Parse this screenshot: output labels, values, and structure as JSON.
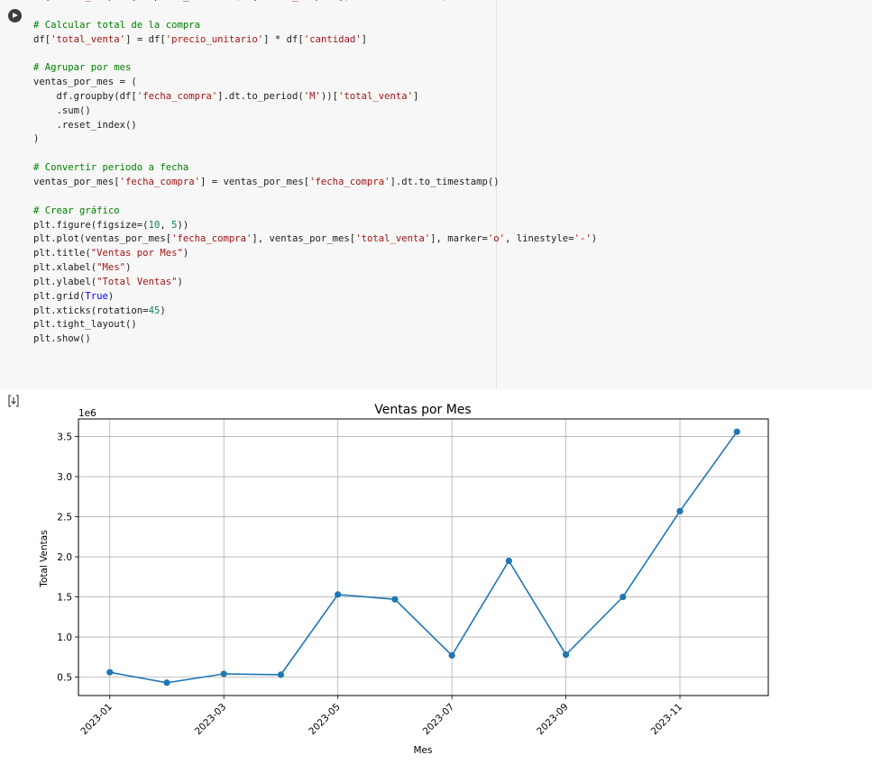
{
  "code_lines": [
    [
      [
        "df[",
        "tok-text"
      ],
      [
        "'fecha_compra'",
        "tok-string"
      ],
      [
        "] = pd.to_datetime(df[",
        "tok-text"
      ],
      [
        "'fecha_compra'",
        "tok-string"
      ],
      [
        "], errors=",
        "tok-text"
      ],
      [
        "'coerce'",
        "tok-string"
      ],
      [
        ")",
        "tok-text"
      ]
    ],
    [],
    [
      [
        "# Calcular total de la compra",
        "tok-comment"
      ]
    ],
    [
      [
        "df[",
        "tok-text"
      ],
      [
        "'total_venta'",
        "tok-string"
      ],
      [
        "] = df[",
        "tok-text"
      ],
      [
        "'precio_unitario'",
        "tok-string"
      ],
      [
        "] * df[",
        "tok-text"
      ],
      [
        "'cantidad'",
        "tok-string"
      ],
      [
        "]",
        "tok-text"
      ]
    ],
    [],
    [
      [
        "# Agrupar por mes",
        "tok-comment"
      ]
    ],
    [
      [
        "ventas_por_mes = (",
        "tok-text"
      ]
    ],
    [
      [
        "    df.groupby(df[",
        "tok-text"
      ],
      [
        "'fecha_compra'",
        "tok-string"
      ],
      [
        "].dt.to_period(",
        "tok-text"
      ],
      [
        "'M'",
        "tok-string"
      ],
      [
        "))[",
        "tok-text"
      ],
      [
        "'total_venta'",
        "tok-string"
      ],
      [
        "]",
        "tok-text"
      ]
    ],
    [
      [
        "    .sum()",
        "tok-text"
      ]
    ],
    [
      [
        "    .reset_index()",
        "tok-text"
      ]
    ],
    [
      [
        ")",
        "tok-text"
      ]
    ],
    [],
    [
      [
        "# Convertir periodo a fecha",
        "tok-comment"
      ]
    ],
    [
      [
        "ventas_por_mes[",
        "tok-text"
      ],
      [
        "'fecha_compra'",
        "tok-string"
      ],
      [
        "] = ventas_por_mes[",
        "tok-text"
      ],
      [
        "'fecha_compra'",
        "tok-string"
      ],
      [
        "].dt.to_timestamp()",
        "tok-text"
      ]
    ],
    [],
    [
      [
        "# Crear gráfico",
        "tok-comment"
      ]
    ],
    [
      [
        "plt.figure(figsize=(",
        "tok-text"
      ],
      [
        "10",
        "tok-number"
      ],
      [
        ", ",
        "tok-text"
      ],
      [
        "5",
        "tok-number"
      ],
      [
        "))",
        "tok-text"
      ]
    ],
    [
      [
        "plt.plot(ventas_por_mes[",
        "tok-text"
      ],
      [
        "'fecha_compra'",
        "tok-string"
      ],
      [
        "], ventas_por_mes[",
        "tok-text"
      ],
      [
        "'total_venta'",
        "tok-string"
      ],
      [
        "], marker=",
        "tok-text"
      ],
      [
        "'o'",
        "tok-string"
      ],
      [
        ", linestyle=",
        "tok-text"
      ],
      [
        "'-'",
        "tok-string"
      ],
      [
        ")",
        "tok-text"
      ]
    ],
    [
      [
        "plt.title(",
        "tok-text"
      ],
      [
        "\"Ventas por Mes\"",
        "tok-string"
      ],
      [
        ")",
        "tok-text"
      ]
    ],
    [
      [
        "plt.xlabel(",
        "tok-text"
      ],
      [
        "\"Mes\"",
        "tok-string"
      ],
      [
        ")",
        "tok-text"
      ]
    ],
    [
      [
        "plt.ylabel(",
        "tok-text"
      ],
      [
        "\"Total Ventas\"",
        "tok-string"
      ],
      [
        ")",
        "tok-text"
      ]
    ],
    [
      [
        "plt.grid(",
        "tok-text"
      ],
      [
        "True",
        "tok-keyword"
      ],
      [
        ")",
        "tok-text"
      ]
    ],
    [
      [
        "plt.xticks(rotation=",
        "tok-text"
      ],
      [
        "45",
        "tok-number"
      ],
      [
        ")",
        "tok-text"
      ]
    ],
    [
      [
        "plt.tight_layout()",
        "tok-text"
      ]
    ],
    [
      [
        "plt.show()",
        "tok-text"
      ]
    ]
  ],
  "icons": {
    "run": "play-icon",
    "output": "output-toggle-icon"
  },
  "colors": {
    "line": "#1f77b4",
    "grid": "#b0b0b0",
    "cell_bg": "#f7f7f7"
  },
  "chart_data": {
    "type": "line",
    "title": "Ventas por Mes",
    "xlabel": "Mes",
    "ylabel": "Total Ventas",
    "y_offset_label": "1e6",
    "x": [
      "2023-01",
      "2023-02",
      "2023-03",
      "2023-04",
      "2023-05",
      "2023-06",
      "2023-07",
      "2023-08",
      "2023-09",
      "2023-10",
      "2023-11",
      "2023-12"
    ],
    "values": [
      0.56,
      0.43,
      0.54,
      0.53,
      1.53,
      1.47,
      0.77,
      1.95,
      0.78,
      1.5,
      2.57,
      3.56
    ],
    "value_unit_multiplier": 1000000,
    "x_ticks": [
      "2023-01",
      "2023-03",
      "2023-05",
      "2023-07",
      "2023-09",
      "2023-11"
    ],
    "y_ticks": [
      "0.5",
      "1.0",
      "1.5",
      "2.0",
      "2.5",
      "3.0",
      "3.5"
    ],
    "ylim": [
      0.27,
      3.72
    ],
    "grid": true,
    "marker": "o",
    "linestyle": "-"
  }
}
